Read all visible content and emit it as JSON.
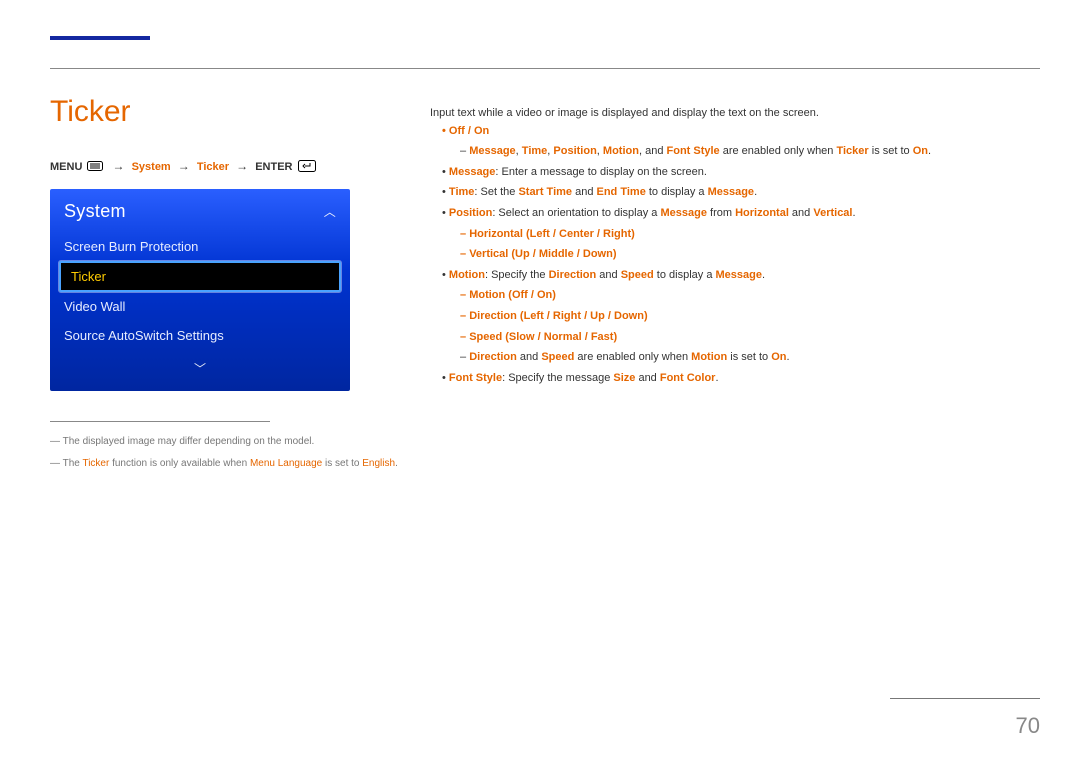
{
  "pageNumber": "70",
  "section": {
    "title": "Ticker"
  },
  "breadcrumb": {
    "menu": "MENU",
    "system": "System",
    "ticker": "Ticker",
    "enter": "ENTER"
  },
  "osd": {
    "header": "System",
    "items": {
      "screenBurn": "Screen Burn Protection",
      "ticker": "Ticker",
      "videoWall": "Video Wall",
      "sourceAuto": "Source AutoSwitch Settings"
    }
  },
  "notes": {
    "n1_pre": "The displayed image may differ depending on the model.",
    "n2_a": "The ",
    "n2_b": "Ticker",
    "n2_c": " function is only available when ",
    "n2_d": "Menu Language",
    "n2_e": " is set to ",
    "n2_f": "English",
    "n2_g": "."
  },
  "right": {
    "intro": "Input text while a video or image is displayed and display the text on the screen.",
    "offon": "Off / On",
    "dash1_a": "Message",
    "dash1_b": ", ",
    "dash1_c": "Time",
    "dash1_d": ", ",
    "dash1_e": "Position",
    "dash1_f": ", ",
    "dash1_g": "Motion",
    "dash1_h": ", and ",
    "dash1_i": "Font Style",
    "dash1_j": " are enabled only when ",
    "dash1_k": "Ticker",
    "dash1_l": " is set to ",
    "dash1_m": "On",
    "dash1_n": ".",
    "msg_a": "Message",
    "msg_b": ": Enter a message to display on the screen.",
    "time_a": "Time",
    "time_b": ": Set the ",
    "time_c": "Start Time",
    "time_d": " and ",
    "time_e": "End Time",
    "time_f": " to display a ",
    "time_g": "Message",
    "time_h": ".",
    "pos_a": "Position",
    "pos_b": ": Select an orientation to display a ",
    "pos_c": "Message",
    "pos_d": " from ",
    "pos_e": "Horizontal",
    "pos_f": " and ",
    "pos_g": "Vertical",
    "pos_h": ".",
    "posH": "Horizontal (Left / Center / Right)",
    "posV": "Vertical (Up / Middle / Down)",
    "mot_a": "Motion",
    "mot_b": ": Specify the ",
    "mot_c": "Direction",
    "mot_d": " and ",
    "mot_e": "Speed",
    "mot_f": " to display a ",
    "mot_g": "Message",
    "mot_h": ".",
    "motOnOff": "Motion (Off / On)",
    "motDir": "Direction (Left / Right / Up / Down)",
    "motSpd": "Speed (Slow / Normal / Fast)",
    "motNote_a": "Direction",
    "motNote_b": " and ",
    "motNote_c": "Speed",
    "motNote_d": " are enabled only when ",
    "motNote_e": "Motion",
    "motNote_f": " is set to ",
    "motNote_g": "On",
    "motNote_h": ".",
    "font_a": "Font Style",
    "font_b": ": Specify the message ",
    "font_c": "Size",
    "font_d": " and ",
    "font_e": "Font Color",
    "font_f": "."
  }
}
